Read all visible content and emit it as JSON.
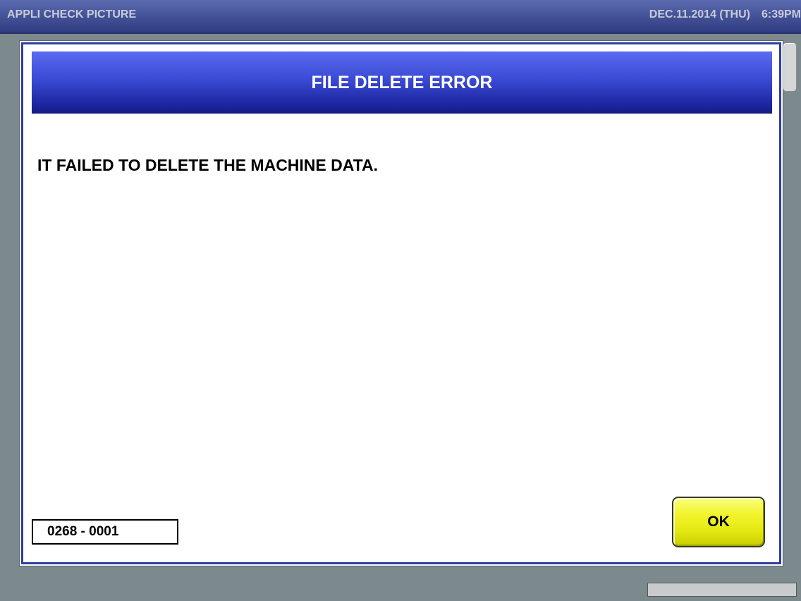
{
  "titlebar": {
    "app_title": "APPLI CHECK PICTURE",
    "date": "DEC.11.2014 (THU)",
    "time": "6:39PM"
  },
  "dialog": {
    "title": "FILE DELETE ERROR",
    "message": "IT FAILED TO DELETE THE MACHINE DATA.",
    "error_code": "0268 - 0001",
    "ok_label": "OK"
  },
  "colors": {
    "header_blue": "#3a4ad4",
    "ok_yellow": "#f2f42a",
    "background_gray": "#7c8a8d"
  }
}
